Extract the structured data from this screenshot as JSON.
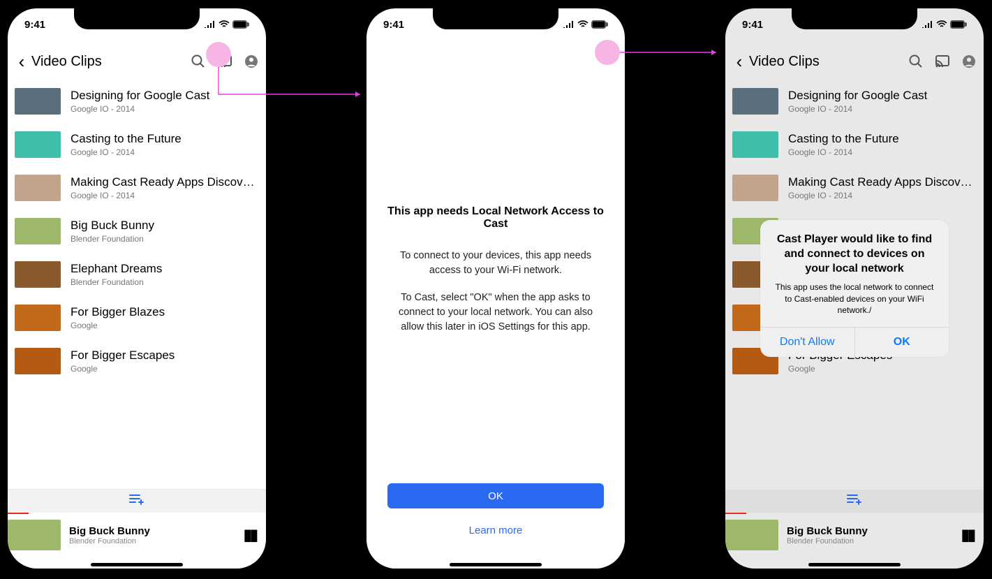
{
  "status": {
    "time": "9:41"
  },
  "page": {
    "title": "Video Clips"
  },
  "videos": [
    {
      "title": "Designing for Google Cast",
      "sub": "Google IO - 2014",
      "thumb": "#5b6e7c"
    },
    {
      "title": "Casting to the Future",
      "sub": "Google IO - 2014",
      "thumb": "#3fbfa9"
    },
    {
      "title": "Making Cast Ready Apps Discover...",
      "sub": "Google IO - 2014",
      "thumb": "#c1a48a"
    },
    {
      "title": "Big Buck Bunny",
      "sub": "Blender Foundation",
      "thumb": "#9db86a"
    },
    {
      "title": "Elephant Dreams",
      "sub": "Blender Foundation",
      "thumb": "#8a5a2e"
    },
    {
      "title": "For Bigger Blazes",
      "sub": "Google",
      "thumb": "#c06a1a"
    },
    {
      "title": "For Bigger Escapes",
      "sub": "Google",
      "thumb": "#b55a12"
    }
  ],
  "player": {
    "title": "Big Buck Bunny",
    "sub": "Blender Foundation",
    "progress_pct": 8
  },
  "info": {
    "title": "This app needs Local Network Access to Cast",
    "p1": "To connect to your devices, this app needs access to your Wi-Fi network.",
    "p2": "To Cast, select \"OK\" when the app asks to connect to your local network. You can also allow this later in iOS Settings for this app.",
    "ok": "OK",
    "learn": "Learn more"
  },
  "alert": {
    "title": "Cast Player would like to find and connect to devices on your local network",
    "body": "This app uses the local network to connect to Cast-enabled devices on your WiFi network./",
    "deny": "Don't Allow",
    "ok": "OK"
  }
}
